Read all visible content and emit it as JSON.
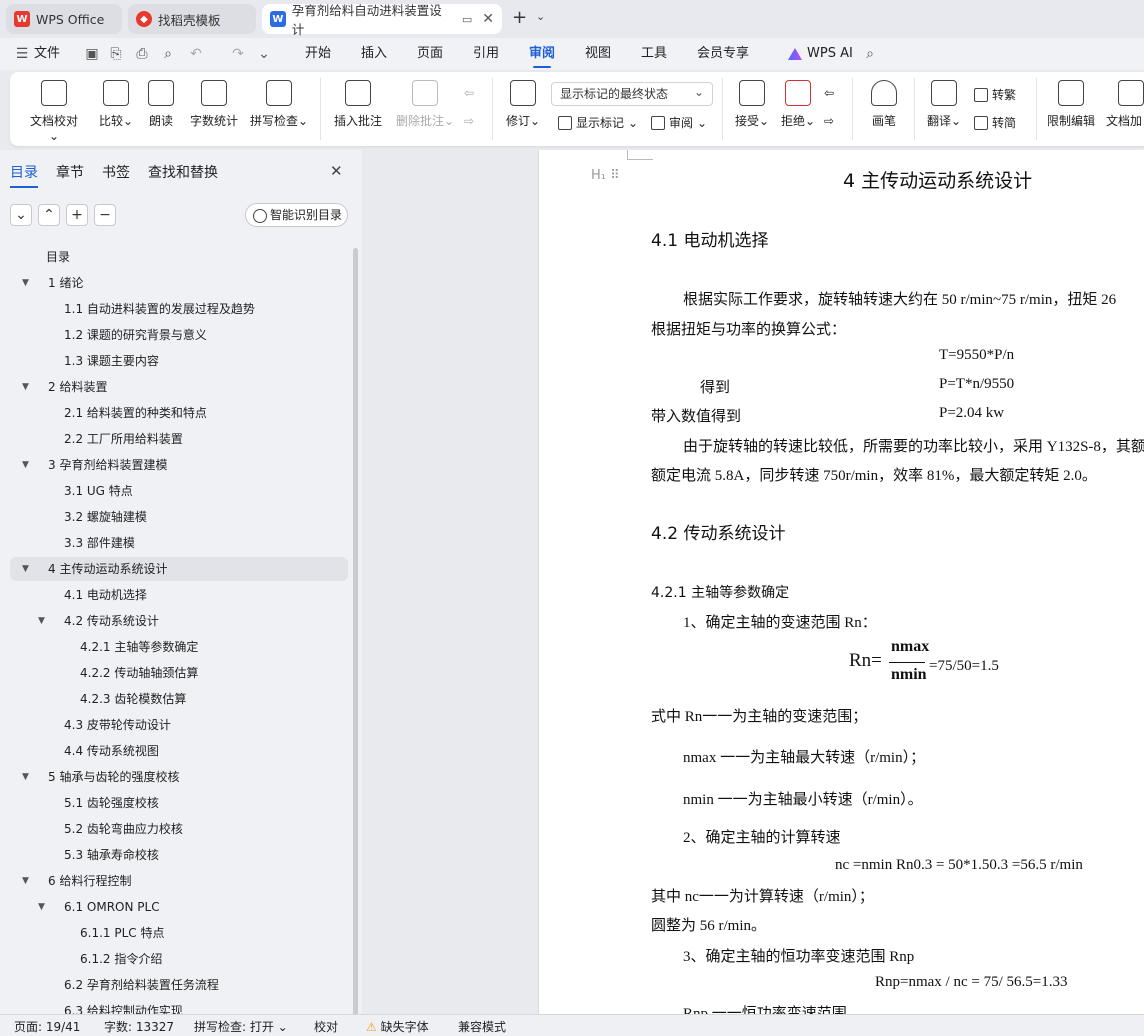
{
  "tabs": [
    {
      "label": "WPS Office"
    },
    {
      "label": "找稻壳模板"
    },
    {
      "label": "孕育剂给料自动进料装置设计"
    }
  ],
  "menu": [
    "文件",
    "开始",
    "插入",
    "页面",
    "引用",
    "审阅",
    "视图",
    "工具",
    "会员专享",
    "WPS AI"
  ],
  "menu_active": "审阅",
  "ribbon": {
    "doc_check": "文档校对",
    "compare": "比较",
    "read_aloud": "朗读",
    "word_count": "字数统计",
    "spell_check": "拼写检查",
    "insert_comment": "插入批注",
    "delete_comment": "删除批注",
    "revise": "修订",
    "markup_dropdown": "显示标记的最终状态",
    "show_markup": "显示标记",
    "review": "审阅",
    "accept": "接受",
    "reject": "拒绝",
    "pen": "画笔",
    "translate": "翻译",
    "to_traditional": "转繁",
    "to_simplified": "转简",
    "restrict_edit": "限制编辑",
    "doc_encrypt": "文档加"
  },
  "sidebar": {
    "tabs": [
      "目录",
      "章节",
      "书签",
      "查找和替换"
    ],
    "smart_button": "智能识别目录",
    "toc": [
      {
        "text": "目录",
        "level": 0,
        "arrow": ""
      },
      {
        "text": "1   绪论",
        "level": 0,
        "arrow": "▼"
      },
      {
        "text": "1.1 自动进料装置的发展过程及趋势",
        "level": 1,
        "arrow": ""
      },
      {
        "text": "1.2 课题的研究背景与意义",
        "level": 1,
        "arrow": ""
      },
      {
        "text": "1.3 课题主要内容",
        "level": 1,
        "arrow": ""
      },
      {
        "text": "2   给料装置",
        "level": 0,
        "arrow": "▼"
      },
      {
        "text": "2.1 给料装置的种类和特点",
        "level": 1,
        "arrow": ""
      },
      {
        "text": "2.2 工厂所用给料装置",
        "level": 1,
        "arrow": ""
      },
      {
        "text": "3  孕育剂给料装置建模",
        "level": 0,
        "arrow": "▼"
      },
      {
        "text": "3.1 UG 特点",
        "level": 1,
        "arrow": ""
      },
      {
        "text": "3.2 螺旋轴建模",
        "level": 1,
        "arrow": ""
      },
      {
        "text": "3.3 部件建模",
        "level": 1,
        "arrow": ""
      },
      {
        "text": "4   主传动运动系统设计",
        "level": 0,
        "arrow": "▼",
        "selected": true
      },
      {
        "text": "4.1 电动机选择",
        "level": 1,
        "arrow": ""
      },
      {
        "text": "4.2 传动系统设计",
        "level": 1,
        "arrow": "▼"
      },
      {
        "text": "4.2.1 主轴等参数确定",
        "level": 2,
        "arrow": ""
      },
      {
        "text": "4.2.2 传动轴轴颈估算",
        "level": 2,
        "arrow": ""
      },
      {
        "text": "4.2.3 齿轮模数估算",
        "level": 2,
        "arrow": ""
      },
      {
        "text": "4.3 皮带轮传动设计",
        "level": 1,
        "arrow": ""
      },
      {
        "text": "4.4 传动系统视图",
        "level": 1,
        "arrow": ""
      },
      {
        "text": "5   轴承与齿轮的强度校核",
        "level": 0,
        "arrow": "▼"
      },
      {
        "text": "5.1 齿轮强度校核",
        "level": 1,
        "arrow": ""
      },
      {
        "text": "5.2 齿轮弯曲应力校核",
        "level": 1,
        "arrow": ""
      },
      {
        "text": "5.3 轴承寿命校核",
        "level": 1,
        "arrow": ""
      },
      {
        "text": "6   给料行程控制",
        "level": 0,
        "arrow": "▼"
      },
      {
        "text": "6.1 OMRON PLC",
        "level": 1,
        "arrow": "▼"
      },
      {
        "text": "6.1.1 PLC 特点",
        "level": 2,
        "arrow": ""
      },
      {
        "text": "6.1.2 指令介绍",
        "level": 2,
        "arrow": ""
      },
      {
        "text": "6.2 孕育剂给料装置任务流程",
        "level": 1,
        "arrow": ""
      },
      {
        "text": "6.3 给料控制动作实现",
        "level": 1,
        "arrow": ""
      }
    ]
  },
  "doc": {
    "chapter_title": "4   主传动运动系统设计",
    "h41": "4.1 电动机选择",
    "p1": "根据实际工作要求，旋转轴转速大约在 50 r/min~75 r/min，扭矩 26",
    "p2": "根据扭矩与功率的换算公式：",
    "f1": "T=9550*P/n",
    "f2_label": "得到",
    "f2": "P=T*n/9550",
    "f3_label": "带入数值得到",
    "f3": "P=2.04 kw",
    "p3": "由于旋转轴的转速比较低，所需要的功率比较小，采用 Y132S-8，其额",
    "p4": "额定电流 5.8A，同步转速 750r/min，效率 81%，最大额定转矩 2.0。",
    "h42": "4.2 传动系统设计",
    "h421": "4.2.1 主轴等参数确定",
    "s1": "1、确定主轴的变速范围 Rn：",
    "rn_lhs": "Rn=",
    "rn_num": "nmax",
    "rn_den": "nmin",
    "rn_rhs": "=75/50=1.5",
    "d1": "式中 Rn一一为主轴的变速范围；",
    "d2": "nmax 一一为主轴最大转速（r/min）；",
    "d3": "nmin 一一为主轴最小转速（r/min）。",
    "s2": "2、确定主轴的计算转速",
    "nc_formula": "nc =nmin Rn0.3 = 50*1.50.3 =56.5 r/min",
    "d4": "其中 nc一一为计算转速（r/min）；",
    "d5": "圆整为 56 r/min。",
    "s3": "3、确定主轴的恒功率变速范围 Rnp",
    "rnp_formula": "Rnp=nmax / nc = 75/ 56.5=1.33",
    "d6": "Rnp 一一恒功率变速范围。"
  },
  "status": {
    "page": "页面: 19/41",
    "words": "字数: 13327",
    "spell": "拼写检查: 打开",
    "proof": "校对",
    "missing_font": "缺失字体",
    "compat": "兼容模式"
  },
  "colors": {
    "accent": "#1f5fd6",
    "wps_red": "#e8382f"
  }
}
